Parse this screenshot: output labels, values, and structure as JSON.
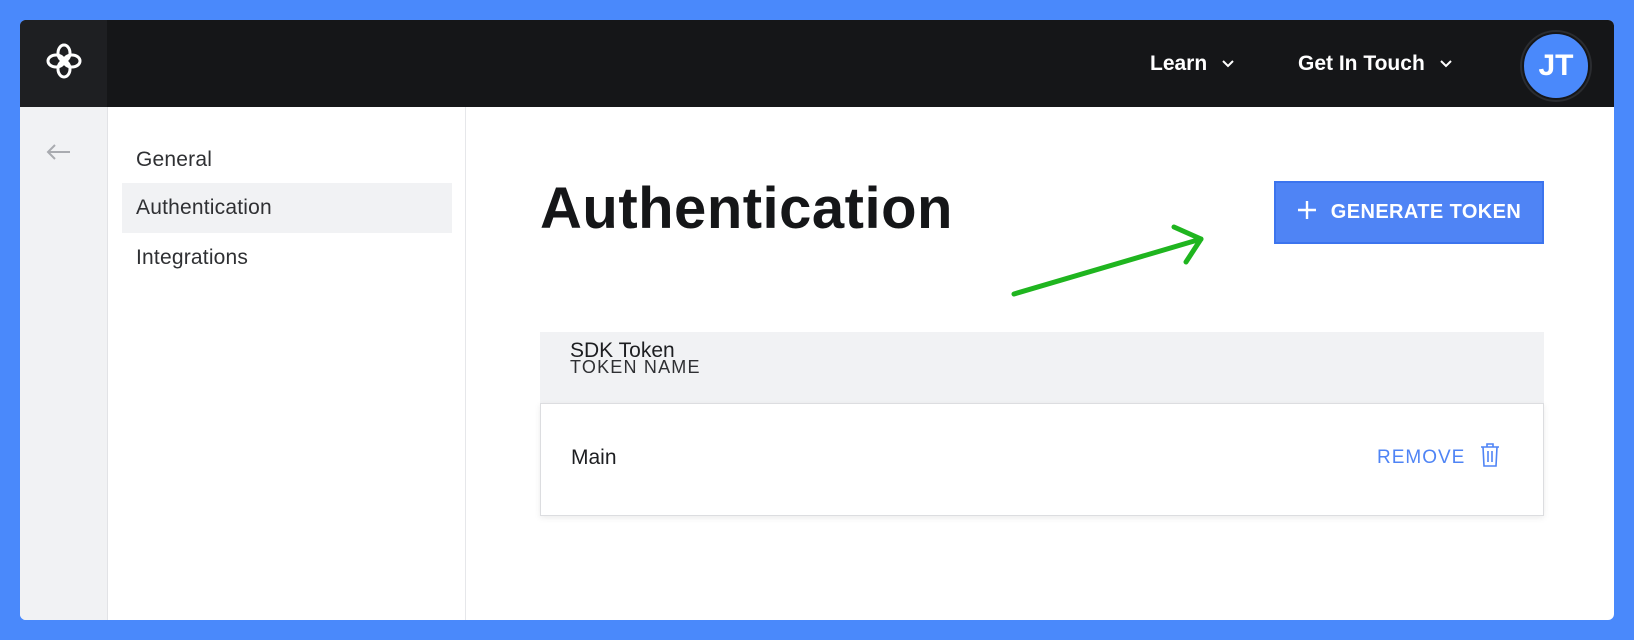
{
  "topbar": {
    "logo_icon": "flower-logo-icon",
    "nav": [
      {
        "label": "Learn",
        "icon": "chevron-down-icon"
      },
      {
        "label": "Get In Touch",
        "icon": "chevron-down-icon"
      }
    ],
    "avatar_initials": "JT"
  },
  "rail": {
    "back_icon": "arrow-left-icon"
  },
  "sidebar": {
    "items": [
      {
        "label": "General",
        "active": false
      },
      {
        "label": "Authentication",
        "active": true
      },
      {
        "label": "Integrations",
        "active": false
      }
    ]
  },
  "main": {
    "title": "Authentication",
    "generate_button": {
      "label": "GENERATE TOKEN",
      "icon": "plus-icon"
    },
    "annotation_icon": "green-arrow-icon",
    "table": {
      "header": "TOKEN NAME",
      "rows": [
        {
          "name": "Main",
          "action": "REMOVE",
          "action_icon": "trash-icon"
        },
        {
          "name": "SDK Token"
        }
      ]
    }
  },
  "colors": {
    "accent": "#4f84f5",
    "background": "#4a89fb",
    "topbar": "#151618",
    "annotation": "#1fb51f"
  }
}
